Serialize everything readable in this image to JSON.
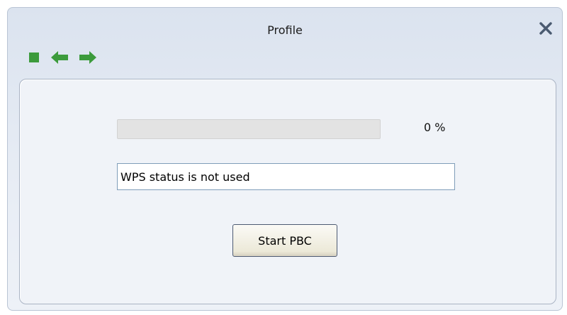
{
  "window": {
    "title": "Profile"
  },
  "toolbar": {
    "items": [
      {
        "icon": "stop-icon",
        "color": "#3c9b3c"
      },
      {
        "icon": "back-arrow-icon",
        "color": "#3c9b3c"
      },
      {
        "icon": "forward-arrow-icon",
        "color": "#3c9b3c"
      }
    ]
  },
  "progress": {
    "value": 0,
    "label": "0 %"
  },
  "status": {
    "value": "WPS status is not used"
  },
  "actions": {
    "start_pbc_label": "Start PBC"
  },
  "colors": {
    "accent": "#3c9b3c",
    "close": "#4a5a70"
  }
}
